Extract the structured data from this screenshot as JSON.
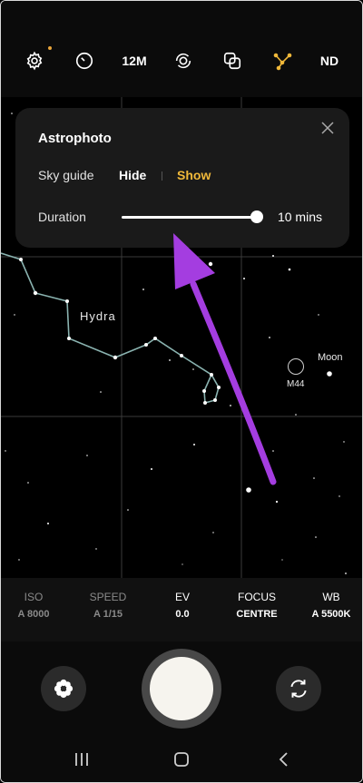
{
  "toolbar": {
    "resolution_label": "12M",
    "nd_label": "ND",
    "icons": [
      "gear-icon",
      "timer-icon",
      "resolution",
      "motion-icon",
      "layers-icon",
      "astro-icon",
      "nd"
    ],
    "notify_color": "#e9a53b"
  },
  "panel": {
    "title": "Astrophoto",
    "sky_guide_label": "Sky guide",
    "hide_label": "Hide",
    "show_label": "Show",
    "duration_label": "Duration",
    "duration_value": "10 mins",
    "duration_fraction": 1.0,
    "show_color": "#f1b93a"
  },
  "sky": {
    "constellation_label": "Hydra",
    "m44_label": "M44",
    "moon_label": "Moon"
  },
  "settings": {
    "items": [
      {
        "label": "ISO",
        "value": "A 8000"
      },
      {
        "label": "SPEED",
        "value": "A 1/15"
      },
      {
        "label": "EV",
        "value": "0.0"
      },
      {
        "label": "FOCUS",
        "value": "CENTRE"
      },
      {
        "label": "WB",
        "value": "A 5500K"
      }
    ]
  },
  "annotation": {
    "arrow_color": "#a43de0"
  }
}
